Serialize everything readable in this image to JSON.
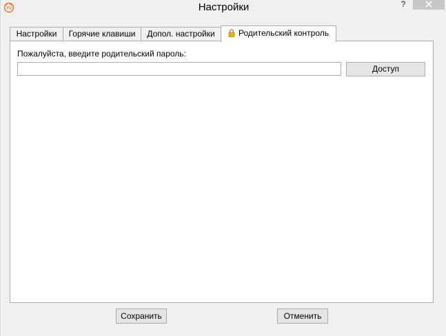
{
  "window": {
    "title": "Настройки",
    "help_label": "?"
  },
  "tabs": [
    {
      "label": "Настройки",
      "active": false
    },
    {
      "label": "Горячие клавиши",
      "active": false
    },
    {
      "label": "Допол. настройки",
      "active": false
    },
    {
      "label": "Родительский контроль",
      "active": true,
      "icon": "lock-icon"
    }
  ],
  "parental": {
    "prompt": "Пожалуйста, введите родительский пароль:",
    "password_value": "",
    "access_label": "Доступ"
  },
  "footer": {
    "save_label": "Сохранить",
    "cancel_label": "Отменить"
  },
  "colors": {
    "background": "#f0f0f0",
    "panel": "#ffffff",
    "border": "#adadad",
    "button": "#e5e5e5",
    "close_button": "#c7c7c7",
    "lock": "#e8b800"
  }
}
